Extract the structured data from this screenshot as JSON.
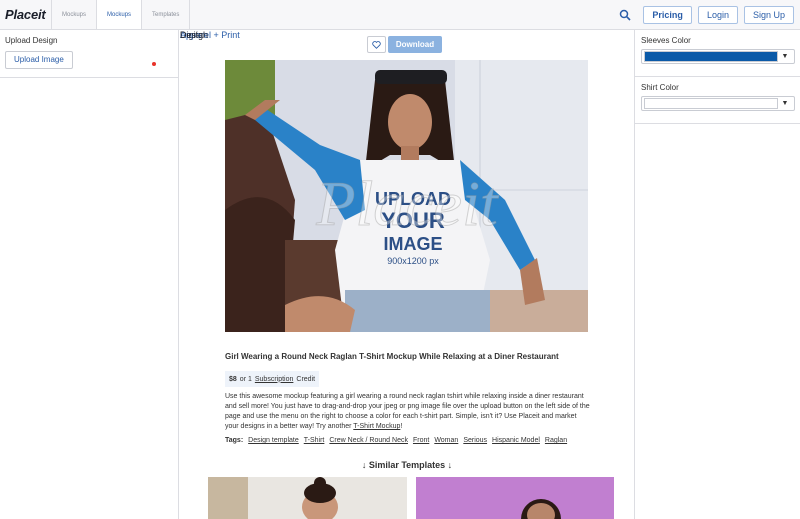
{
  "header": {
    "logo": "Placeit",
    "tabs": [
      {
        "main": "Digital",
        "sub": "Mockups"
      },
      {
        "main": "Apparel + Print",
        "sub": "Mockups"
      },
      {
        "main": "Design",
        "sub": "Templates"
      }
    ],
    "buttons": {
      "pricing": "Pricing",
      "login": "Login",
      "signup": "Sign Up"
    },
    "icons": {
      "search": "search-icon"
    }
  },
  "left": {
    "upload_label": "Upload Design",
    "upload_button": "Upload Image"
  },
  "right": {
    "sleeves_label": "Sleeves Color",
    "sleeves_color": "#0b5aa8",
    "shirt_label": "Shirt Color",
    "shirt_color": "#ffffff"
  },
  "main": {
    "download_label": "Download",
    "watermark": "Placeit",
    "shirt_print": [
      "UPLOAD",
      "YOUR",
      "IMAGE",
      "900x1200 px"
    ],
    "title": "Girl Wearing a Round Neck Raglan T-Shirt Mockup While Relaxing at a Diner Restaurant",
    "price": "$8",
    "price_or": "or 1",
    "subscription": "Subscription",
    "credit": "Credit",
    "description": "Use this awesome mockup featuring a girl wearing a round neck raglan tshirt while relaxing inside a diner restaurant and sell more! You just have to drag-and-drop your jpeg or png image file over the upload button on the left side of the page and use the menu on the right to choose a color for each t-shirt part. Simple, isn't it? Use Placeit and market your designs in a better way! Try another",
    "description_link": "T-Shirt Mockup",
    "description_end": "!",
    "tags_label": "Tags:",
    "tags": [
      "Design template",
      "T-Shirt",
      "Crew Neck / Round Neck",
      "Front",
      "Woman",
      "Serious",
      "Hispanic Model",
      "Raglan"
    ],
    "similar_heading": "↓ Similar Templates ↓"
  }
}
